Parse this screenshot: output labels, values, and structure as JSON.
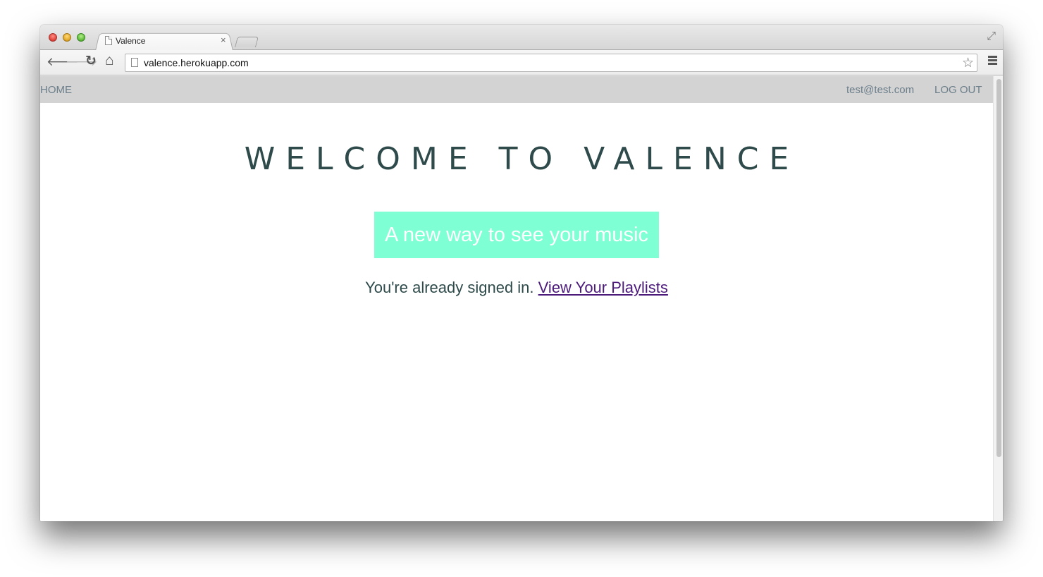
{
  "browser": {
    "tab_title": "Valence",
    "tab_close": "×",
    "url": "valence.herokuapp.com",
    "back_icon": "🡐",
    "forward_icon": "🡒",
    "reload_icon": "↻",
    "home_icon": "⌂",
    "star_icon": "☆",
    "fullscreen_icon": "⤢"
  },
  "site_nav": {
    "home": "HOME",
    "user_email": "test@test.com",
    "logout": "LOG OUT"
  },
  "hero": {
    "title": "WELCOME TO VALENCE",
    "tagline": "A new way to see your music",
    "signed_in_text": "You're already signed in.",
    "playlists_link": "View Your Playlists"
  },
  "colors": {
    "nav_bg": "#d3d3d3",
    "nav_link": "#6b7e8a",
    "title": "#2e4a4a",
    "tagline_bg": "#7fffd4",
    "visited_link": "#4b1a7a"
  }
}
